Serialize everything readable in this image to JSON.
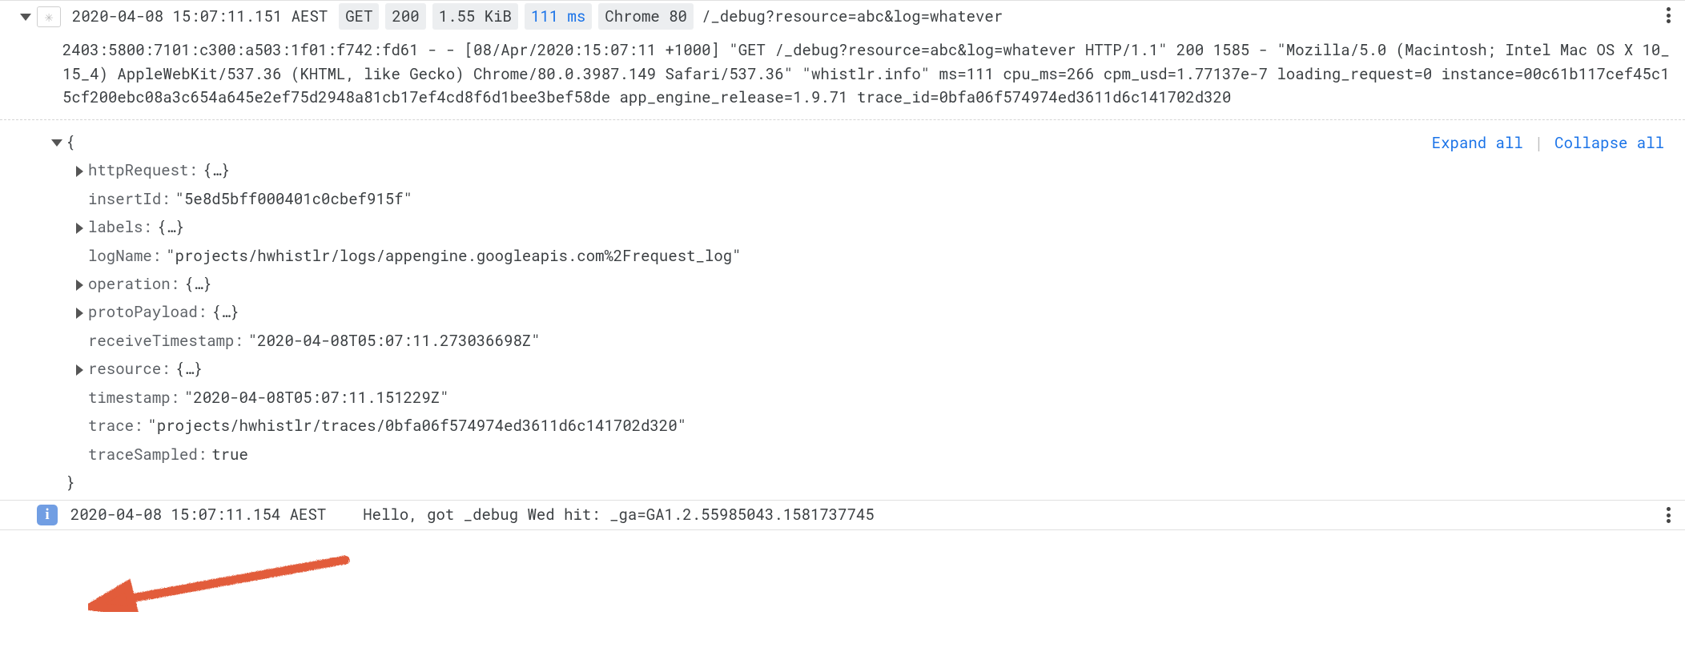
{
  "header": {
    "timestamp": "2020-04-08 15:07:11.151 AEST",
    "method": "GET",
    "status": "200",
    "size": "1.55 KiB",
    "latency": "111 ms",
    "userAgent": "Chrome 80",
    "path": "/_debug?resource=abc&log=whatever"
  },
  "rawLog": "2403:5800:7101:c300:a503:1f01:f742:fd61 - - [08/Apr/2020:15:07:11 +1000] \"GET /_debug?resource=abc&log=whatever HTTP/1.1\" 200 1585 - \"Mozilla/5.0 (Macintosh; Intel Mac OS X 10_15_4) AppleWebKit/537.36 (KHTML, like Gecko) Chrome/80.0.3987.149 Safari/537.36\" \"whistlr.info\" ms=111 cpu_ms=266 cpm_usd=1.77137e-7 loading_request=0 instance=00c61b117cef45c15cf200ebc08a3c654a645e2ef75d2948a81cb17ef4cd8f6d1bee3bef58de app_engine_release=1.9.71 trace_id=0bfa06f574974ed3611d6c141702d320",
  "controls": {
    "expand": "Expand all",
    "collapse": "Collapse all"
  },
  "json": {
    "openBrace": "{",
    "closeBrace": "}",
    "placeholder": "{…}",
    "fields": {
      "httpRequest": "httpRequest:",
      "insertId_k": "insertId:",
      "insertId_v": "\"5e8d5bff000401c0cbef915f\"",
      "labels": "labels:",
      "logName_k": "logName:",
      "logName_v": "\"projects/hwhistlr/logs/appengine.googleapis.com%2Frequest_log\"",
      "operation": "operation:",
      "protoPayload": "protoPayload:",
      "receiveTimestamp_k": "receiveTimestamp:",
      "receiveTimestamp_v": "\"2020-04-08T05:07:11.273036698Z\"",
      "resource": "resource:",
      "timestamp_k": "timestamp:",
      "timestamp_v": "\"2020-04-08T05:07:11.151229Z\"",
      "trace_k": "trace:",
      "trace_v": "\"projects/hwhistlr/traces/0bfa06f574974ed3611d6c141702d320\"",
      "traceSampled_k": "traceSampled:",
      "traceSampled_v": "true"
    }
  },
  "footer": {
    "timestamp": "2020-04-08 15:07:11.154 AEST",
    "message": "Hello, got _debug Wed hit: _ga=GA1.2.55985043.1581737745",
    "infoGlyph": "i"
  }
}
